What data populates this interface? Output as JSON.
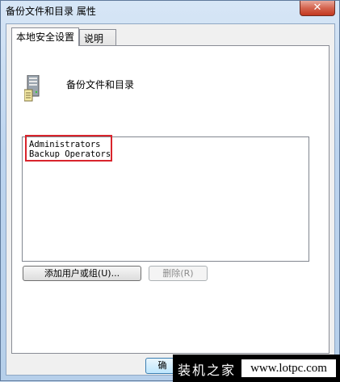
{
  "window": {
    "title": "备份文件和目录 属性",
    "close_symbol": "✕"
  },
  "tabs": [
    {
      "label": "本地安全设置",
      "active": true
    },
    {
      "label": "说明",
      "active": false
    }
  ],
  "panel": {
    "icon": "server-icon",
    "policy_name": "备份文件和目录",
    "members": [
      "Administrators",
      "Backup Operators"
    ],
    "add_button_label": "添加用户或组(U)...",
    "remove_button_label": "删除(R)"
  },
  "footer": {
    "ok_button_label": "确"
  },
  "watermark": {
    "left_text": "装机之家",
    "right_text": "www.lotpc.com"
  },
  "colors": {
    "highlight": "#d9242c",
    "close_button": "#c2381f"
  }
}
